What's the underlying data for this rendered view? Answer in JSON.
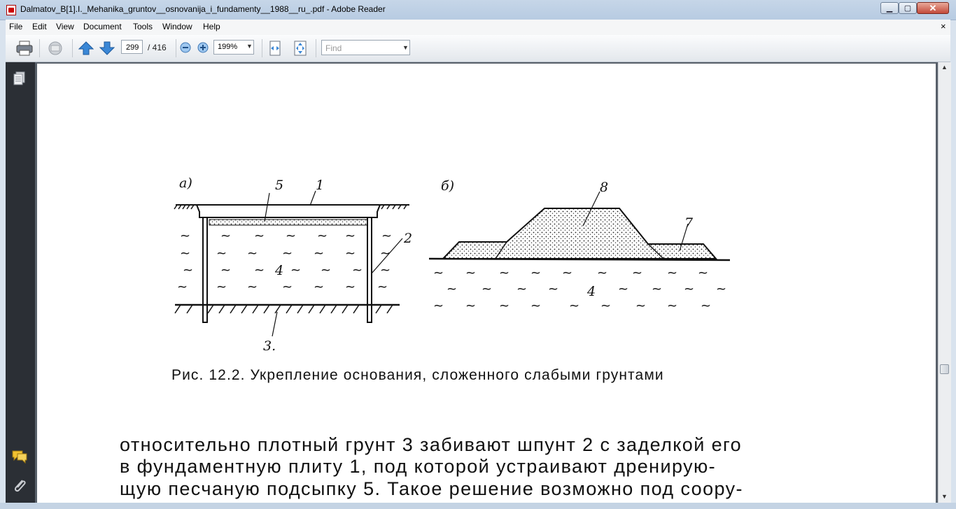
{
  "window": {
    "title": "Dalmatov_B[1].I._Mehanika_gruntov__osnovanija_i_fundamenty__1988__ru_.pdf - Adobe Reader",
    "minimize": "▁",
    "maximize": "▢",
    "close": "✕"
  },
  "menubar": {
    "items": [
      "File",
      "Edit",
      "View",
      "Document",
      "Tools",
      "Window",
      "Help"
    ],
    "close_doc": "×"
  },
  "toolbar": {
    "page_current": "299",
    "page_total": "/ 416",
    "zoom": "199%",
    "find_placeholder": "Find"
  },
  "figure": {
    "label_a": "а)",
    "label_b": "б)",
    "callouts": [
      "5",
      "1",
      "2",
      "4",
      "3.",
      "8",
      "7",
      "4"
    ],
    "caption": "Рис. 12.2. Укрепление основания, сложенного слабыми грунтами"
  },
  "body": {
    "lines": [
      "относительно плотный грунт 3 забивают шпунт 2 с заделкой его",
      "в фундаментную плиту 1, под которой устраивают дренирую-",
      "щую песчаную подсыпку 5. Такое решение возможно под соору-"
    ]
  },
  "icons": [
    "pdf-app-icon",
    "print-icon",
    "email-icon",
    "previous-page-icon",
    "next-page-icon",
    "zoom-out-icon",
    "zoom-in-icon",
    "fit-width-icon",
    "fit-page-icon",
    "pages-panel-icon",
    "comments-icon",
    "attachments-icon"
  ]
}
